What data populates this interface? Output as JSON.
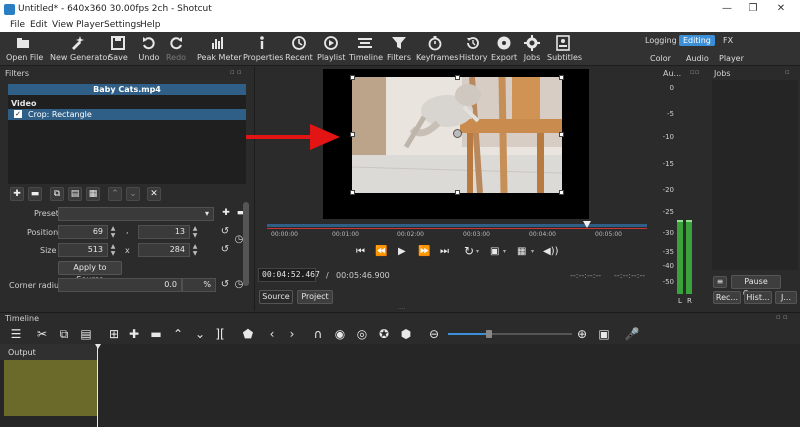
{
  "window": {
    "title": "Untitled* - 640x360 30.00fps 2ch - Shotcut",
    "minimize": "—",
    "restore": "❐",
    "close": "✕"
  },
  "menu": [
    "File",
    "Edit",
    "View",
    "Player",
    "Settings",
    "Help"
  ],
  "toolbar": {
    "items": [
      {
        "label": "Open File",
        "icon": "open-file-icon",
        "disabled": false
      },
      {
        "label": "New Generator",
        "icon": "new-generator-icon",
        "disabled": false
      },
      {
        "label": "Save",
        "icon": "save-icon",
        "disabled": false
      },
      {
        "label": "Undo",
        "icon": "undo-icon",
        "disabled": false
      },
      {
        "label": "Redo",
        "icon": "redo-icon",
        "disabled": true
      },
      {
        "label": "Peak Meter",
        "icon": "peak-meter-icon",
        "disabled": false
      },
      {
        "label": "Properties",
        "icon": "properties-icon",
        "disabled": false
      },
      {
        "label": "Recent",
        "icon": "recent-icon",
        "disabled": false
      },
      {
        "label": "Playlist",
        "icon": "playlist-icon",
        "disabled": false
      },
      {
        "label": "Timeline",
        "icon": "timeline-icon",
        "disabled": false
      },
      {
        "label": "Filters",
        "icon": "filters-icon",
        "disabled": false
      },
      {
        "label": "Keyframes",
        "icon": "keyframes-icon",
        "disabled": false
      },
      {
        "label": "History",
        "icon": "history-icon",
        "disabled": false
      },
      {
        "label": "Export",
        "icon": "export-icon",
        "disabled": false
      },
      {
        "label": "Jobs",
        "icon": "jobs-icon",
        "disabled": false
      },
      {
        "label": "Subtitles",
        "icon": "subtitles-icon",
        "disabled": false
      }
    ],
    "layouts": {
      "logging": "Logging",
      "editing": "Editing",
      "fx": "FX",
      "color": "Color",
      "audio": "Audio",
      "player": "Player",
      "active": "editing"
    }
  },
  "filters": {
    "panel_title": "Filters",
    "clip_name": "Baby Cats.mp4",
    "group": "Video",
    "filter_item": "Crop: Rectangle",
    "filter_checked": true,
    "preset_label": "Preset",
    "position_label": "Position",
    "position_x": "69",
    "position_y": "13",
    "position_sep": ",",
    "size_label": "Size",
    "size_w": "513",
    "size_h": "284",
    "size_sep": "x",
    "apply_button": "Apply to Source",
    "corner_label": "Corner radius",
    "corner_value": "0.0",
    "corner_unit": "%"
  },
  "viewer": {
    "ruler": [
      "00:00:00",
      "00:01:00",
      "00:02:00",
      "00:03:00",
      "00:04:00",
      "00:05:00"
    ],
    "current_time": "00:04:52.467",
    "slash": "/",
    "total_time": "00:05:46.900",
    "in_point": "--:--:--:--",
    "out_point": "--:--:--:--",
    "tab_source": "Source",
    "tab_project": "Project",
    "playhead_fraction": 0.842
  },
  "audio": {
    "panel_title": "Au...",
    "db_scale": [
      "0",
      "-5",
      "-10",
      "-15",
      "-20",
      "-25",
      "-30",
      "-35",
      "-40",
      "-50"
    ],
    "channel_left": "L",
    "channel_right": "R"
  },
  "jobs": {
    "panel_title": "Jobs",
    "pause_queue": "Pause Queue",
    "tabs": [
      "Rec...",
      "Hist...",
      "J..."
    ],
    "menu_icon": "≡"
  },
  "timeline": {
    "panel_title": "Timeline",
    "track_name": "Output"
  },
  "colors": {
    "accent": "#3c8fd6",
    "list_highlight": "#2f5f86",
    "meter_green": "#3aa23a",
    "clip_olive": "#6b6a2a",
    "arrow_red": "#e31414"
  }
}
